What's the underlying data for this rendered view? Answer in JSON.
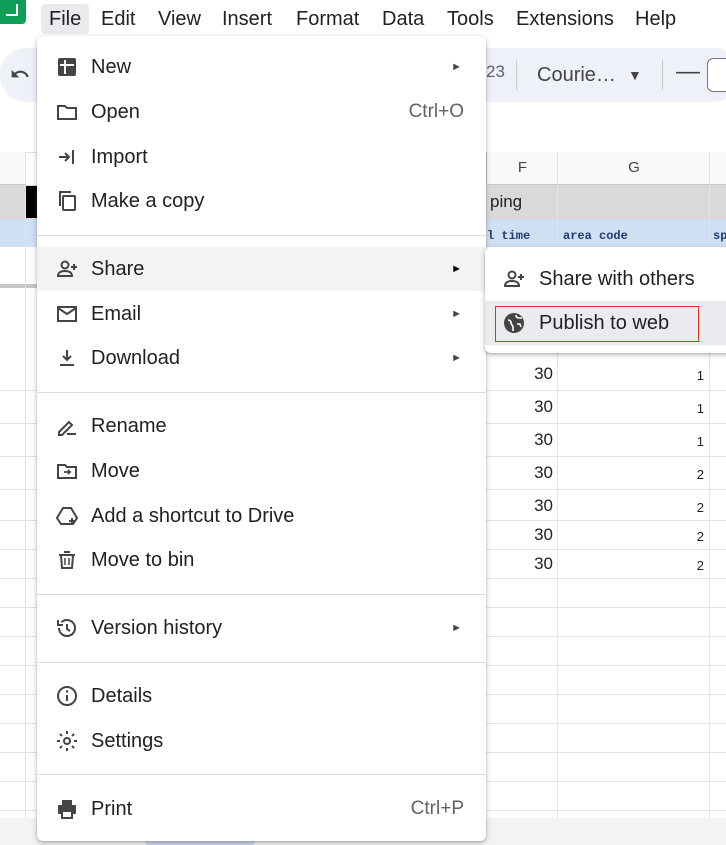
{
  "menubar": {
    "items": [
      "File",
      "Edit",
      "View",
      "Insert",
      "Format",
      "Data",
      "Tools",
      "Extensions",
      "Help"
    ]
  },
  "toolbar": {
    "zoom_partial": "23",
    "font_name": "Courie…",
    "minus_label": "—"
  },
  "sheet": {
    "columns": [
      "F",
      "G"
    ],
    "header_partial_f": "ping",
    "subheader_f": "l time",
    "subheader_g": "area code",
    "subheader_h": "sp",
    "rows_f": [
      "30",
      "30",
      "30",
      "30",
      "30",
      "30",
      "30"
    ],
    "rows_g": [
      "1",
      "1",
      "1",
      "2",
      "2",
      "2",
      "2"
    ]
  },
  "file_menu": {
    "items": [
      {
        "label": "New",
        "icon": "new-sheet-icon",
        "arrow": true
      },
      {
        "label": "Open",
        "icon": "folder-icon",
        "shortcut": "Ctrl+O"
      },
      {
        "label": "Import",
        "icon": "import-icon"
      },
      {
        "label": "Make a copy",
        "icon": "copy-icon"
      },
      {
        "label": "Share",
        "icon": "add-person-icon",
        "arrow": true
      },
      {
        "label": "Email",
        "icon": "mail-icon",
        "arrow": true
      },
      {
        "label": "Download",
        "icon": "download-icon",
        "arrow": true
      },
      {
        "label": "Rename",
        "icon": "rename-icon"
      },
      {
        "label": "Move",
        "icon": "move-folder-icon"
      },
      {
        "label": "Add a shortcut to Drive",
        "icon": "drive-shortcut-icon"
      },
      {
        "label": "Move to bin",
        "icon": "trash-icon"
      },
      {
        "label": "Version history",
        "icon": "history-icon",
        "arrow": true
      },
      {
        "label": "Details",
        "icon": "info-icon"
      },
      {
        "label": "Settings",
        "icon": "gear-icon"
      },
      {
        "label": "Print",
        "icon": "printer-icon",
        "shortcut": "Ctrl+P"
      }
    ],
    "arrow_glyph": "►"
  },
  "share_submenu": {
    "items": [
      {
        "label": "Share with others",
        "icon": "add-person-icon"
      },
      {
        "label": "Publish to web",
        "icon": "globe-icon"
      }
    ]
  },
  "colors": {
    "accent": "#0f9d58",
    "menu_highlight": "#f1f3f4",
    "focus_ring": "#d93025"
  }
}
